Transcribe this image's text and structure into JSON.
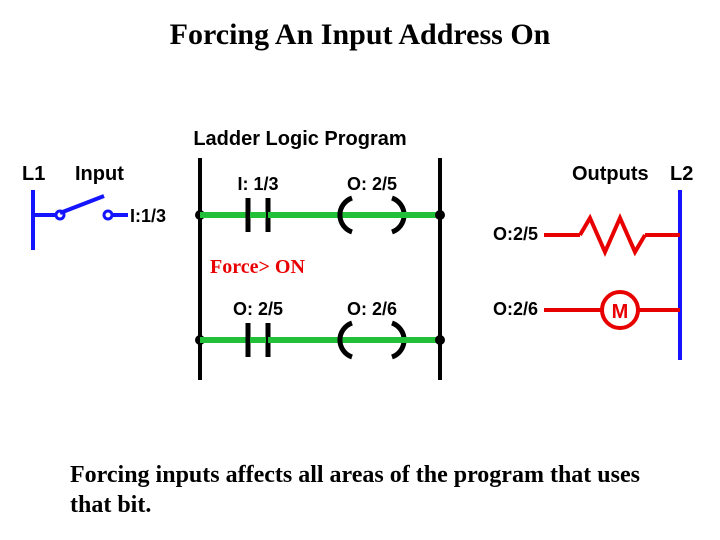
{
  "title": "Forcing An Input Address On",
  "caption": "Forcing inputs affects all areas of the program that uses that bit.",
  "force_text": "Force> ON",
  "input_label": "Input",
  "outputs_label": "Outputs",
  "ladder_title": "Ladder Logic Program",
  "rails": {
    "L1": "L1",
    "L2": "L2"
  },
  "addresses": {
    "input": "I:1/3",
    "rung1_contact": "I: 1/3",
    "rung1_coil": "O: 2/5",
    "rung2_contact": "O: 2/5",
    "rung2_coil": "O: 2/6",
    "out1": "O:2/5",
    "out2": "O:2/6"
  },
  "motor_letter": "M",
  "colors": {
    "rail": "#1414ff",
    "true": "#22c038",
    "false": "#e80000",
    "text": "#000000"
  }
}
